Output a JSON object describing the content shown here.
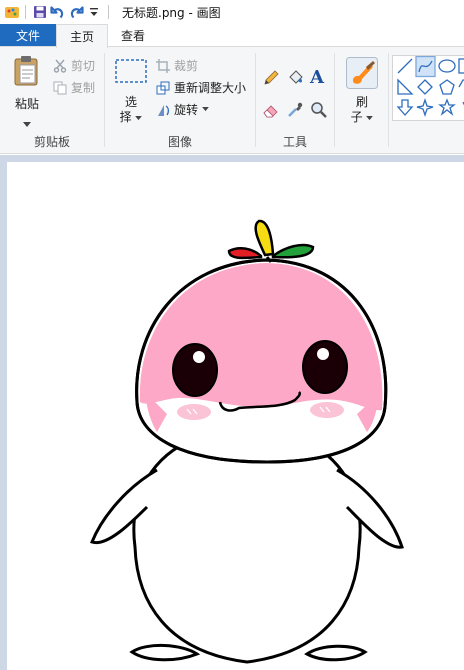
{
  "window": {
    "title": "无标题.png - 画图"
  },
  "tabs": {
    "file": "文件",
    "home": "主页",
    "view": "查看"
  },
  "clipboard": {
    "paste": "粘贴",
    "cut": "剪切",
    "copy": "复制",
    "group": "剪贴板"
  },
  "image": {
    "select_line1": "选",
    "select_line2": "择",
    "crop": "裁剪",
    "resize": "重新调整大小",
    "rotate": "旋转",
    "group": "图像"
  },
  "tools": {
    "group": "工具",
    "text_tool": "A"
  },
  "brushes": {
    "line1": "刷",
    "line2": "子"
  },
  "colors": {
    "accent": "#1e6bc0",
    "ribbon_bg": "#f5f6f7",
    "workspace_bg": "#cdd7e6",
    "character_pink": "#fda8c6",
    "blush": "#fbc3d6",
    "leaf_yellow": "#f5dc13",
    "leaf_red": "#e31e24",
    "leaf_green": "#22a03a"
  },
  "icons": [
    "paint-app-icon",
    "save-icon",
    "undo-icon",
    "redo-icon",
    "customize-quick-access-icon",
    "paste-icon",
    "cut-icon",
    "copy-icon",
    "select-icon",
    "crop-icon",
    "resize-icon",
    "rotate-icon",
    "pencil-icon",
    "fill-icon",
    "text-icon",
    "eraser-icon",
    "color-picker-icon",
    "magnifier-icon",
    "brush-icon"
  ]
}
